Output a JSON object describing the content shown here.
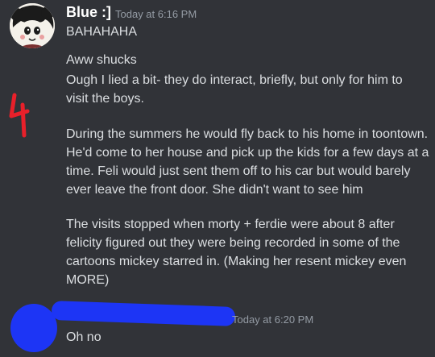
{
  "message1": {
    "author": "Blue :]",
    "timestamp": "Today at 6:16 PM",
    "lines": {
      "l1": "BAHAHAHA",
      "l2": "Aww shucks"
    },
    "para1": {
      "a": "Ough I lied a bit- they do interact, briefly, but only for him to",
      "b": "visit the boys."
    },
    "para2": {
      "a": "During the summers he would fly back to his home in toontown.",
      "b": "He'd come to her house and pick up the kids for a few days at a",
      "c": "time. Feli would just sent them off to his car but would barely",
      "d": "ever leave the front door. She didn't want to see him"
    },
    "para3": {
      "a": "The visits stopped when morty + ferdie were about 8 after",
      "b": "felicity figured out they were being recorded in some of the",
      "c": "cartoons mickey starred in. (Making her resent mickey even",
      "d": "MORE)"
    }
  },
  "message2": {
    "timestamp": "Today at 6:20 PM",
    "text": "Oh no"
  },
  "colors": {
    "background": "#313338",
    "text": "#dbdee1",
    "muted": "#949ba4",
    "redact_blue": "#1d35f5",
    "annotation_red": "#e8202a"
  }
}
